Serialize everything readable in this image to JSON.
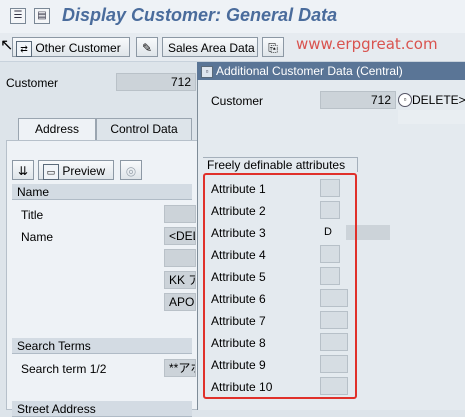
{
  "window": {
    "title": "Display Customer: General Data"
  },
  "toolbar": {
    "other_customer": "Other Customer",
    "sales_area_data": "Sales Area Data",
    "watermark": "www.erpgreat.com"
  },
  "customer": {
    "label": "Customer",
    "value": "712"
  },
  "tabs": [
    {
      "label": "Address"
    },
    {
      "label": "Control Data"
    }
  ],
  "address": {
    "preview_label": "Preview",
    "name_group": "Name",
    "title_label": "Title",
    "name_label": "Name",
    "name_value": "<DEL",
    "name_line3": "KK アオ",
    "name_line4": "APOL",
    "search_group": "Search Terms",
    "search_label": "Search term 1/2",
    "search_value": "**アホ",
    "street_group": "Street Address"
  },
  "popup": {
    "title": "Additional Customer Data  (Central)",
    "customer_label": "Customer",
    "customer_value": "712",
    "customer_name": "DELETE>@",
    "attributes_title": "Freely definable attributes",
    "attributes": [
      {
        "label": "Attribute 1",
        "value": ""
      },
      {
        "label": "Attribute 2",
        "value": ""
      },
      {
        "label": "Attribute 3",
        "value": "D"
      },
      {
        "label": "Attribute 4",
        "value": ""
      },
      {
        "label": "Attribute 5",
        "value": ""
      },
      {
        "label": "Attribute 6",
        "value": ""
      },
      {
        "label": "Attribute 7",
        "value": ""
      },
      {
        "label": "Attribute 8",
        "value": ""
      },
      {
        "label": "Attribute 9",
        "value": ""
      },
      {
        "label": "Attribute 10",
        "value": ""
      }
    ]
  },
  "colors": {
    "title": "#4a6c9c",
    "watermark": "#d9534f",
    "highlight": "#e0302a",
    "popup_titlebar": "#5a7596"
  }
}
